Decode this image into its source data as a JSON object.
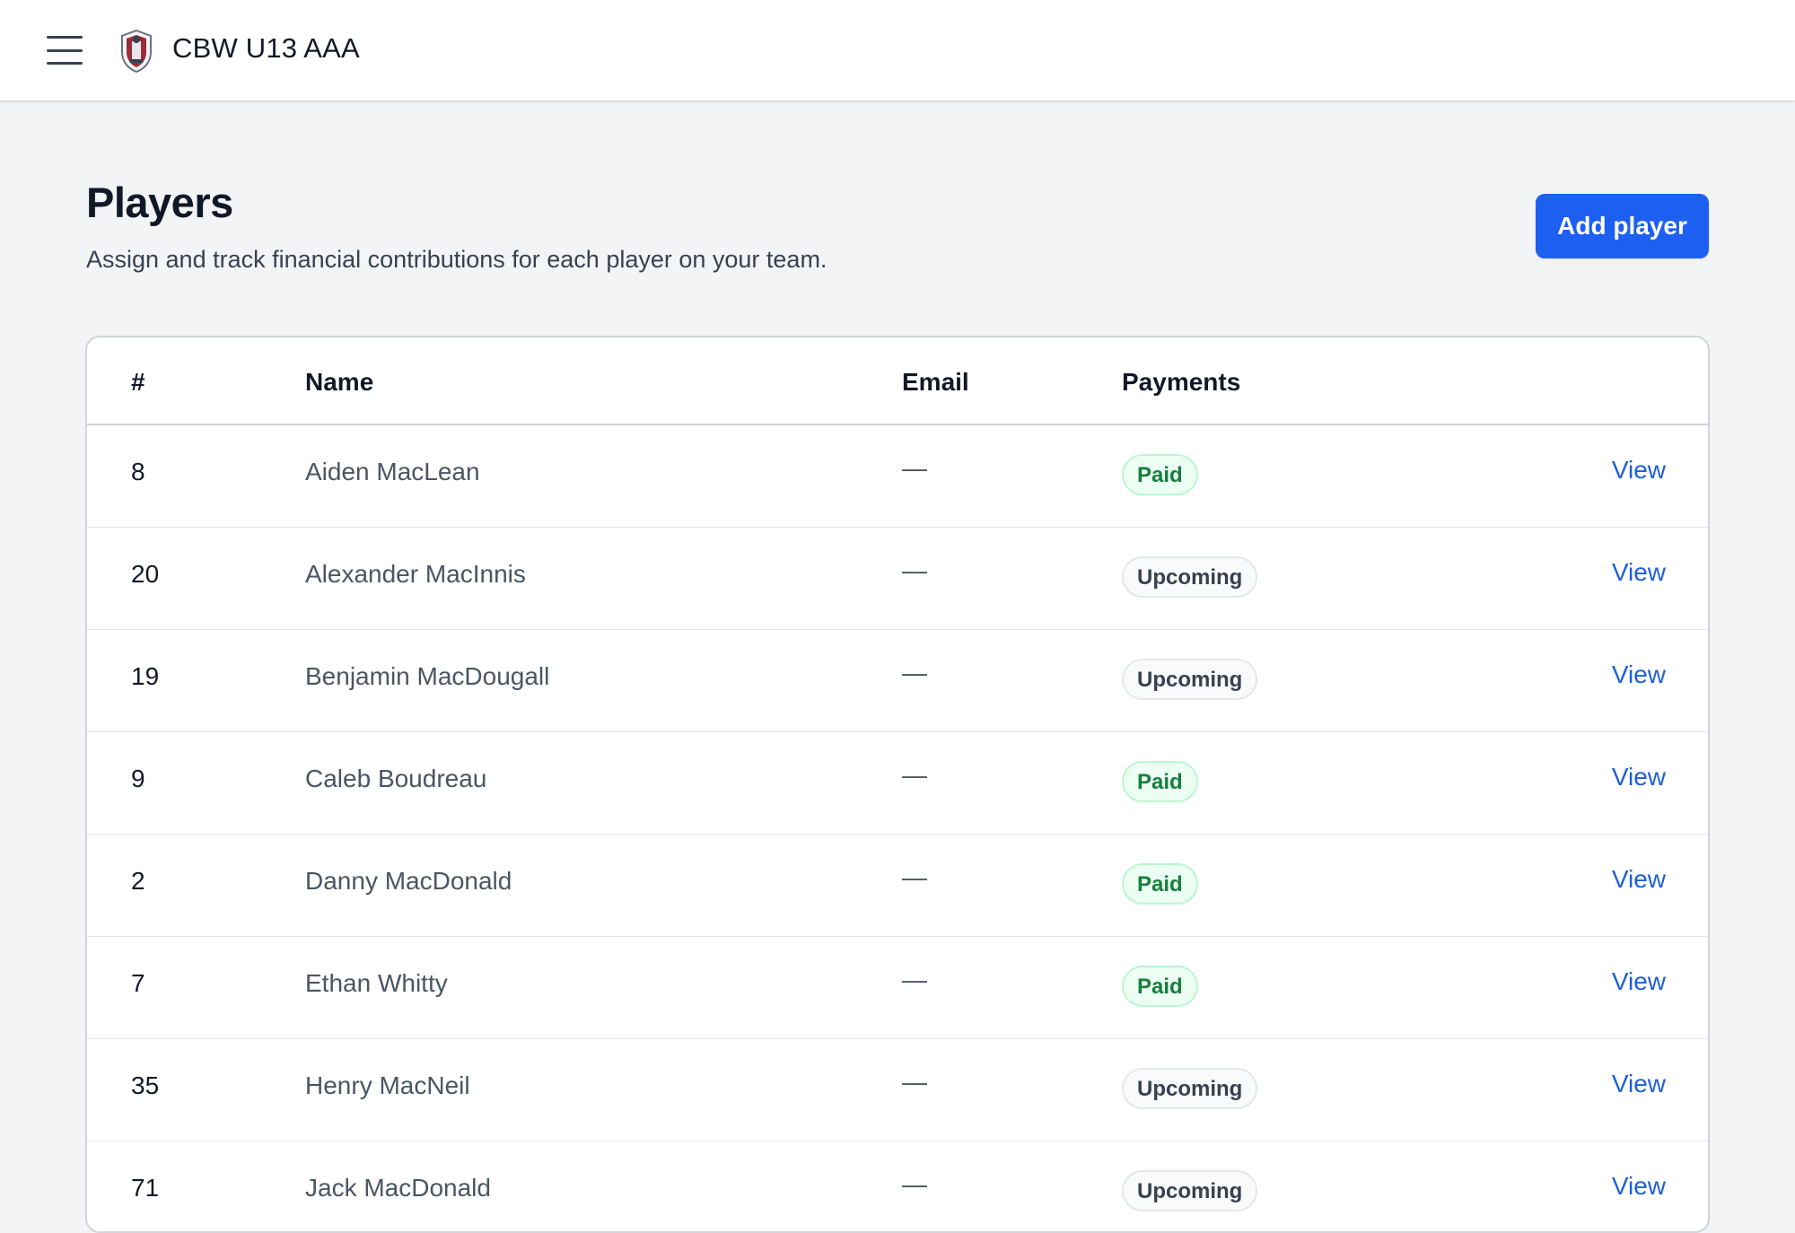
{
  "header": {
    "team_name": "CBW U13 AAA",
    "menu_icon": "hamburger-menu-icon",
    "logo_icon": "team-crest-logo"
  },
  "page": {
    "title": "Players",
    "subtitle": "Assign and track financial contributions for each player on your team.",
    "add_button_label": "Add player"
  },
  "table": {
    "columns": {
      "number": "#",
      "name": "Name",
      "email": "Email",
      "payments": "Payments"
    },
    "rows": [
      {
        "number": "8",
        "name": "Aiden MacLean",
        "email": "—",
        "payment": "Paid",
        "status": "paid",
        "action": "View"
      },
      {
        "number": "20",
        "name": "Alexander MacInnis",
        "email": "—",
        "payment": "Upcoming",
        "status": "upcoming",
        "action": "View"
      },
      {
        "number": "19",
        "name": "Benjamin MacDougall",
        "email": "—",
        "payment": "Upcoming",
        "status": "upcoming",
        "action": "View"
      },
      {
        "number": "9",
        "name": "Caleb Boudreau",
        "email": "—",
        "payment": "Paid",
        "status": "paid",
        "action": "View"
      },
      {
        "number": "2",
        "name": "Danny MacDonald",
        "email": "—",
        "payment": "Paid",
        "status": "paid",
        "action": "View"
      },
      {
        "number": "7",
        "name": "Ethan Whitty",
        "email": "—",
        "payment": "Paid",
        "status": "paid",
        "action": "View"
      },
      {
        "number": "35",
        "name": "Henry MacNeil",
        "email": "—",
        "payment": "Upcoming",
        "status": "upcoming",
        "action": "View"
      },
      {
        "number": "71",
        "name": "Jack MacDonald",
        "email": "—",
        "payment": "Upcoming",
        "status": "upcoming",
        "action": "View"
      }
    ]
  },
  "colors": {
    "primary": "#1d5ff0",
    "link": "#1d5fd6",
    "paid_text": "#15803d",
    "paid_bg": "#ecfdf3",
    "page_bg": "#f3f4f6"
  }
}
